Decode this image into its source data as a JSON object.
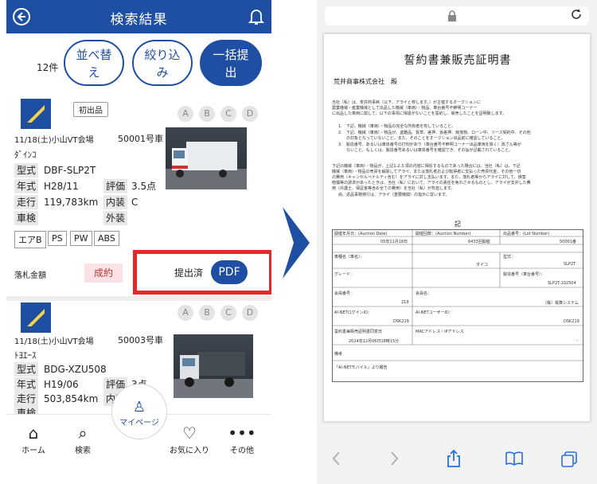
{
  "left": {
    "header_title": "検索結果",
    "count": "12件",
    "pills": [
      {
        "line1": "並べ替",
        "line2": "え"
      },
      {
        "line1": "絞り込",
        "line2": "み"
      },
      {
        "line1": "一括提",
        "line2": "出"
      }
    ],
    "item1": {
      "badge": "初出品",
      "grades": [
        "A",
        "B",
        "C",
        "D"
      ],
      "date_venue": "11/18(土)小山VT会場",
      "lot": "50001号車",
      "maker": "ﾀﾞｲﾝｺ",
      "model_label": "型式",
      "model": "DBF-SLP2T",
      "year_label": "年式",
      "year": "H28/11",
      "score_label": "評価",
      "score": "3.5点",
      "km_label": "走行",
      "km": "119,783km",
      "interior_label": "内装",
      "interior": "C",
      "inspection_label": "車検",
      "exterior_label": "外装",
      "equipment": [
        "エアB",
        "PS",
        "PW",
        "ABS"
      ],
      "bid_label": "落札金額",
      "status": "成約",
      "submitted": "提出済",
      "pdf": "PDF"
    },
    "item2": {
      "grades": [
        "A",
        "B",
        "C",
        "D"
      ],
      "date_venue": "11/18(土)小山VT会場",
      "lot": "50003号車",
      "maker": "ﾄﾖｴｰｽ",
      "model_label": "型式",
      "model": "BDG-XZU508",
      "year_label": "年式",
      "year": "H19/06",
      "score_label": "評価",
      "score": "3点",
      "km_label": "走行",
      "km": "503,854km",
      "interior_label": "内装",
      "inspection_label": "車検"
    },
    "nav": [
      {
        "label": "ホーム",
        "icon": "⌂"
      },
      {
        "label": "検索",
        "icon": "⌕"
      },
      {
        "label": "マイページ",
        "icon": "♙"
      },
      {
        "label": "お気に入り",
        "icon": "♡"
      },
      {
        "label": "その他",
        "icon": "•••"
      }
    ]
  },
  "doc": {
    "title": "誓約書兼販売証明書",
    "company": "荒井商事株式会社　殿",
    "kigo": "記",
    "para1": "当社（私）は、荒井商事㈱（以下、アライと称します。）が主催するオークションに",
    "para1b": "農業機械・産業機械として出品した機械（車両）・物品、車台番号不鮮明コーナー",
    "para1c": "に出品した車両に関して、以下の事項に相違がないことを誓約し、販売したことを証明致します。",
    "items": [
      "1.　下記、機械（車両）・物品の完全な所有者を有していること。",
      "2.　下記、機械（車両）・物品が、盗難品、質草、差押、仮差押、競落物、ローン中、リース契約中、その他",
      "　　の対象となっていないこと。また、そのことをオークション出品前に確認していること。",
      "3.　製造番号、あるいは車体番号の打刻があり（車台番号不鮮明コーナー出品車両を除く）改ざん等が",
      "　　ないこと、もしくは、製造番号あるいは車体番号を確認でき、その旨が記載されていること。"
    ],
    "para2": "下記の機械（車両）・物品が、上記1.2.3.項の内容に相反するものであった場合には、当社（私）は、下記",
    "para2b": "機械（車両）・物品の売買を解除してアライ、または落札者および転得者に支払った売買代金、その他一切",
    "para2c": "の費用（キャンセルペナルティ含む）をアライに対し支払います。また、落札者等からアライに対して、損害",
    "para2d": "賠償等の請求があったときは、当社（私）において、アライの責任を免れさせるものとし、アライが支弁した費",
    "para2e": "用（弁護士、保証金等含め全ての費用）を当社（私）が負担します。",
    "para2f": "尚、返品事務発行は、アライ（重要機関）の指示に従います。",
    "rows": [
      {
        "a": "開催年月日：(Auction Date)",
        "b": "開催回数：(Auction Number)",
        "c": "出品番号：(Lot Number)"
      },
      {
        "a": "05年11月18日",
        "b": "6433回開催",
        "c": "50001番"
      },
      {
        "a": "車種名（車名）：",
        "b": "型式：",
        "c": ""
      },
      {
        "a": "",
        "b": "ダイコ",
        "c": "SLP2T"
      },
      {
        "a": "グレード：",
        "b": "製造番号（車台番号）：",
        "c": ""
      },
      {
        "a": "",
        "b": "",
        "c": "SLP2T-102504"
      },
      {
        "a": "会員番号：",
        "b": "会員名：",
        "c": ""
      },
      {
        "a": "219",
        "b": "",
        "c": "（株）電算システム"
      },
      {
        "a": "AI-NETログインID：",
        "b": "AI-NETユーザーID：",
        "c": ""
      },
      {
        "a": "DSK219",
        "b": "",
        "c": "DSK219"
      },
      {
        "a": "誓約書兼販売証明書同意日",
        "b": "MACアドレス・IPアドレス",
        "c": ""
      },
      {
        "a": "2024年12月06日18時15分",
        "b": "",
        "c": "-"
      }
    ],
    "note_label": "備考",
    "note": "「AI-NETモバイル」より報告"
  }
}
